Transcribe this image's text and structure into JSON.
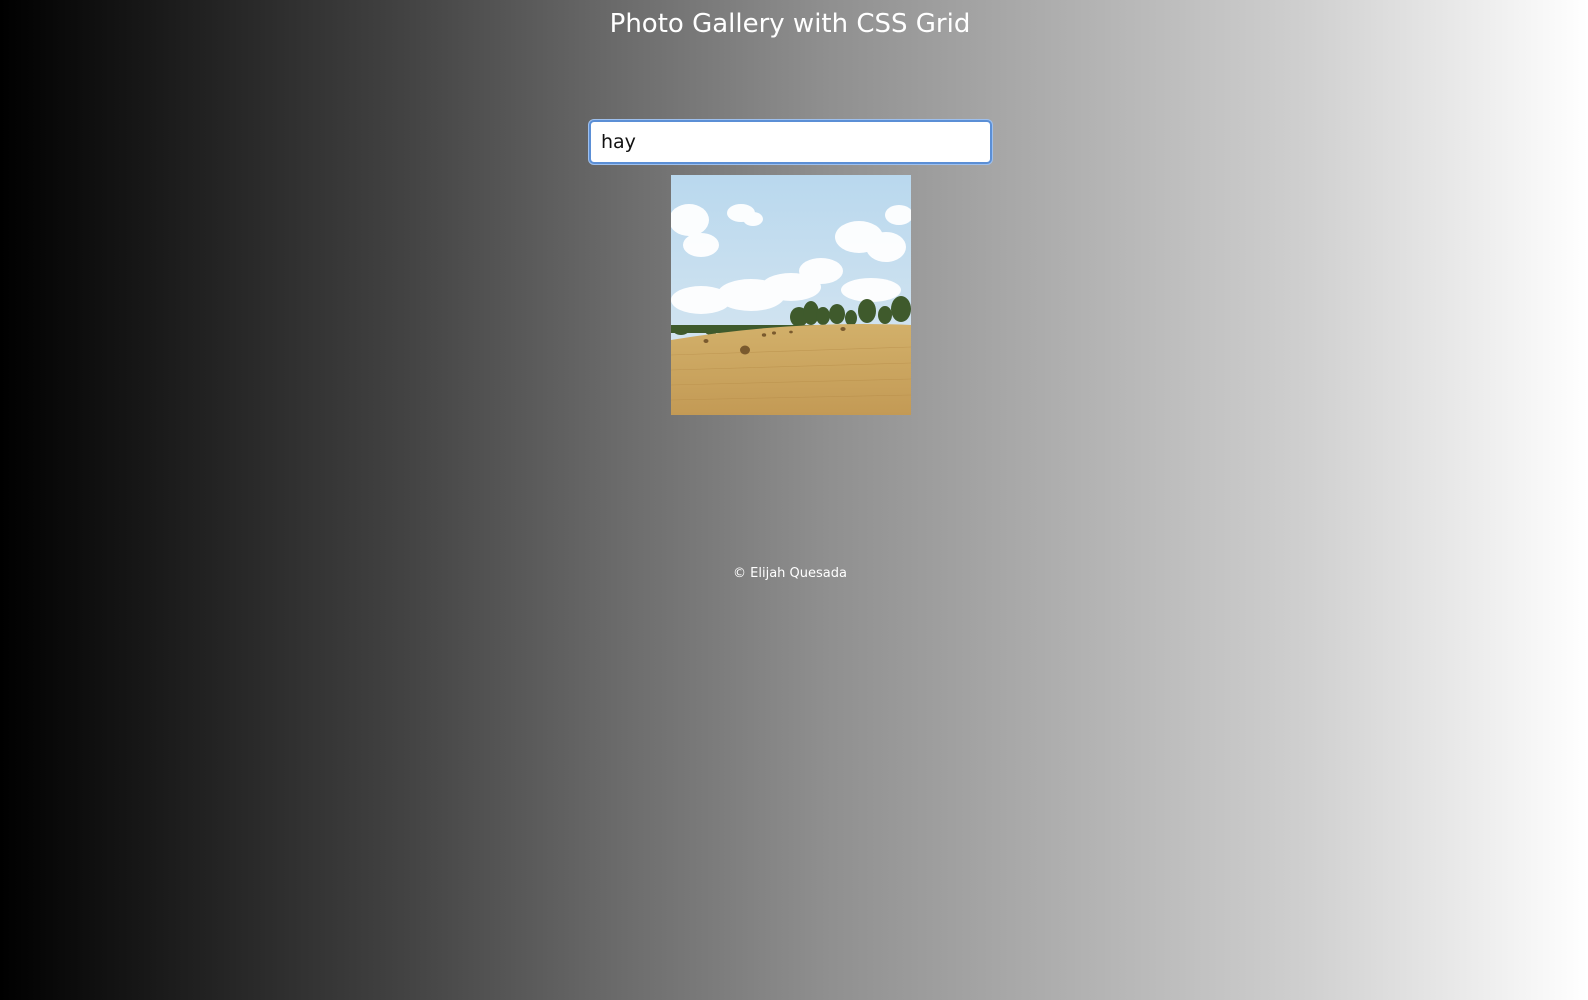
{
  "header": {
    "title": "Photo Gallery with CSS Grid"
  },
  "search": {
    "value": "hay",
    "placeholder": ""
  },
  "gallery": {
    "photos": [
      {
        "subject": "hay field under cloudy sky"
      }
    ]
  },
  "footer": {
    "copyright": "© Elijah Quesada"
  },
  "colors": {
    "text": "#ffffff",
    "focus_ring": "#5b8fd6",
    "background_start": "#000000",
    "background_end": "#ffffff"
  }
}
